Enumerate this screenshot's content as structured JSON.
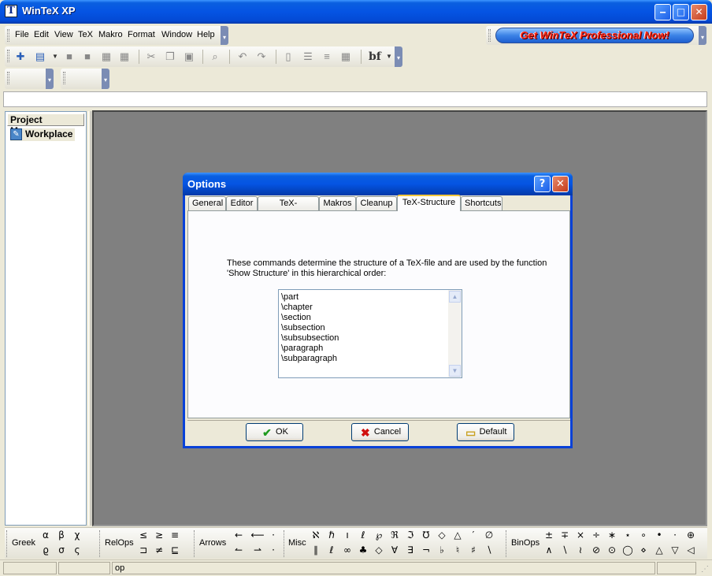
{
  "window": {
    "title": "WinTeX XP",
    "minimize": "‒",
    "maximize": "□",
    "close": "✕"
  },
  "menu": {
    "items": [
      "File",
      "Edit",
      "View",
      "TeX",
      "Makro",
      "Format",
      "Window",
      "Help"
    ]
  },
  "promo": {
    "label": "Get WinTeX Professional Now!"
  },
  "toolbar": {
    "bold_format_label": "bf"
  },
  "project_manager": {
    "header": "Project Manager",
    "item": "Workplace"
  },
  "dialog": {
    "title": "Options",
    "help_glyph": "?",
    "close_glyph": "✕",
    "tabs": [
      "General",
      "Editor",
      "TeX-programs",
      "Makros",
      "Cleanup",
      "TeX-Structure",
      "Shortcuts"
    ],
    "active_tab": "TeX-Structure",
    "description_line1": "These commands determine the structure of a TeX-file and are used by the function",
    "description_line2": "'Show Structure' in this hierarchical order:",
    "structure_commands": [
      "\\part",
      "\\chapter",
      "\\section",
      "\\subsection",
      "\\subsubsection",
      "\\paragraph",
      "\\subparagraph"
    ],
    "buttons": {
      "ok": "OK",
      "cancel": "Cancel",
      "default": "Default"
    }
  },
  "symbol_bar": {
    "groups": [
      {
        "label": "Greek",
        "symbols": [
          "α",
          "β",
          "χ",
          "ϱ",
          "σ",
          "ς"
        ]
      },
      {
        "label": "RelOps",
        "symbols": [
          "≤",
          "≥",
          "≡",
          "⊐",
          "≠",
          "⊑"
        ]
      },
      {
        "label": "Arrows",
        "symbols": [
          "←",
          "⟵",
          "·",
          "↼",
          "⇀",
          "·"
        ]
      },
      {
        "label": "Misc",
        "symbols": [
          "ℵ",
          "ℏ",
          "ı",
          "ℓ",
          "℘",
          "ℜ",
          "ℑ",
          "℧",
          "◇",
          "△",
          "′",
          "∅",
          "∥",
          "ℓ",
          "∞",
          "♣",
          "◇",
          "∀",
          "∃",
          "¬",
          "♭",
          "♮",
          "♯",
          "∖"
        ]
      },
      {
        "label": "BinOps",
        "symbols": [
          "±",
          "∓",
          "×",
          "÷",
          "∗",
          "⋆",
          "∘",
          "•",
          "·",
          "⊕",
          "∧",
          "∖",
          "≀",
          "⊘",
          "⊙",
          "◯",
          "⋄",
          "△",
          "▽",
          "◁"
        ]
      }
    ]
  },
  "statusbar": {
    "field3": "op"
  },
  "colors": {
    "title_blue": "#0554e3",
    "desktop_gray": "#808080",
    "promo_text": "#ff2a1a"
  }
}
